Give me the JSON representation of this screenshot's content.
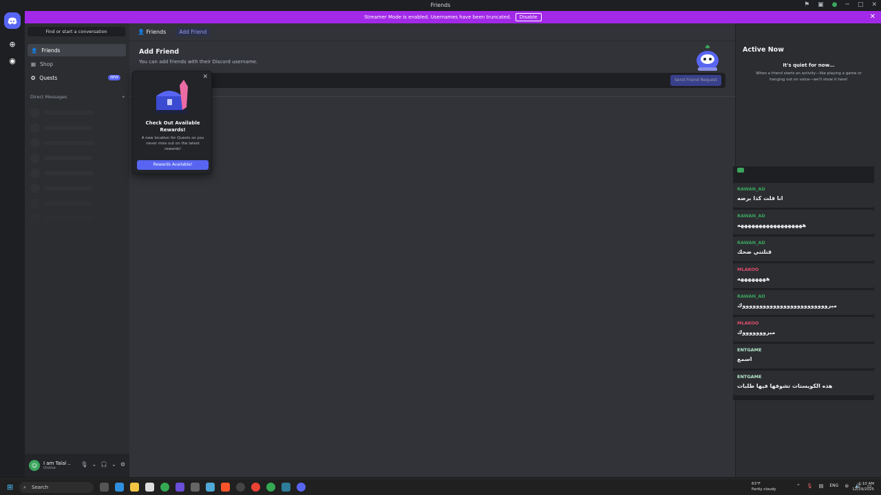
{
  "window": {
    "title": "Friends"
  },
  "banner": {
    "text": "Streamer Mode is enabled. Usernames have been truncated.",
    "disable_label": "Disable"
  },
  "sidebar": {
    "search_label": "Find or start a conversation",
    "items": [
      {
        "label": "Friends",
        "icon": "friends-icon"
      },
      {
        "label": "Shop",
        "icon": "shop-icon"
      },
      {
        "label": "Quests",
        "icon": "quests-icon",
        "badge": "NEW"
      }
    ],
    "dm_header": "Direct Messages",
    "dm_add": "+"
  },
  "user": {
    "name": "I am Talal ..",
    "status": "Online"
  },
  "tabs": {
    "friends": "Friends",
    "add_friend": "Add Friend"
  },
  "add_friend": {
    "heading": "Add Friend",
    "subheading": "You can add friends with their Discord username.",
    "placeholder": "eir Discord username.",
    "send_label": "Send Friend Request"
  },
  "popup": {
    "title": "Check Out Available Rewards!",
    "desc": "A new location for Quests so you never miss out on the latest rewards!",
    "button": "Rewards Available!"
  },
  "active_now": {
    "heading": "Active Now",
    "quiet": "It's quiet for now...",
    "desc": "When a friend starts an activity—like playing a game or hanging out on voice—we'll show it here!"
  },
  "chat": [
    {
      "author": "RAWAN_AD",
      "color": "#3ba55d",
      "text": "انا قلت كذا برضه"
    },
    {
      "author": "RAWAN_AD",
      "color": "#3ba55d",
      "text": "ههههههههههههههههههه"
    },
    {
      "author": "RAWAN_AD",
      "color": "#3ba55d",
      "text": "قتلتني ضحك"
    },
    {
      "author": "MLAKOO",
      "color": "#e04e6e",
      "text": "ههههههههه"
    },
    {
      "author": "RAWAN_AD",
      "color": "#3ba55d",
      "text": "مبروووووووووووووووووووووووووك"
    },
    {
      "author": "MLAKOO",
      "color": "#e04e6e",
      "text": "مبروووووووك"
    },
    {
      "author": "ENTGAME",
      "color": "#b5e8c9",
      "text": "اسمع"
    },
    {
      "author": "ENTGAME",
      "color": "#b5e8c9",
      "text": "هذه الكويستات تشوفها فيها طلبات"
    }
  ],
  "taskbar": {
    "search": "Search",
    "weather_temp": "63°F",
    "weather_desc": "Partly cloudy",
    "lang": "ENG",
    "time": "1:10 AM",
    "date": "12/29/2025"
  }
}
